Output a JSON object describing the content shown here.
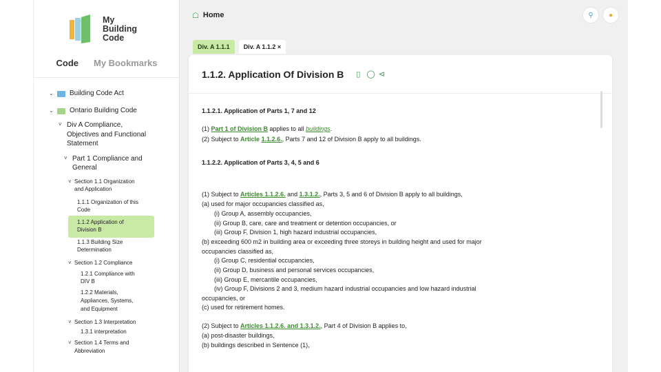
{
  "logo": {
    "line1": "My",
    "line2": "Building",
    "line3": "Code"
  },
  "sidebar": {
    "tab_code": "Code",
    "tab_bookmarks": "My Bookmarks",
    "tree": {
      "act": "Building Code Act",
      "obc": "Ontario Building Code",
      "divA_1": "Div A Compliance,",
      "divA_2": "Objectives and Functional",
      "divA_3": "Statement",
      "part1_1": "Part 1 Compliance and",
      "part1_2": "General",
      "s11_1": "Section 1.1 Organization",
      "s11_2": "and Application",
      "i111_1": "1.1.1 Organization of this",
      "i111_2": "Code",
      "i112_1": "1.1.2 Application of",
      "i112_2": "Division B",
      "i113_1": "1.1.3 Building Size",
      "i113_2": "Determination",
      "s12": "Section 1.2 Compliance",
      "i121_1": "1.2.1 Compliance with",
      "i121_2": "DIV B",
      "i122_1": "1.2.2 Materials,",
      "i122_2": "Appliances,  Systems,",
      "i122_3": "and Equipment",
      "s13": "Section 1.3 Interpretation",
      "i131": "1.3.1 interpretation",
      "s14_1": "Section 1.4 Terms and",
      "s14_2": "Abbreviation"
    }
  },
  "topbar": {
    "home": "Home"
  },
  "tabs": {
    "tab1": "Div. A 1.1.1",
    "tab2": "Div. A 1.1.2 ×"
  },
  "article": {
    "title": "1.1.2.  Application Of Division B",
    "h1": "1.1.2.1.  Application of Parts 1, 7 and 12",
    "p1_a": "(1)  ",
    "p1_link": "Part 1 of Division B",
    "p1_b": " applies to all ",
    "p1_term": "buildings",
    "p1_c": ".",
    "p2_a": "(2)  Subject to ",
    "p2_link1": "Article",
    "p2_sp": " ",
    "p2_link2": "1.1.2.6.",
    "p2_b": ", Parts 7 and 12 of Division B apply to all buildings.",
    "h2": "1.1.2.2.  Application of Parts 3, 4, 5 and 6",
    "q1_a": "(1)  Subject to ",
    "q1_link1": "Articles 1.1.2.6.",
    "q1_b": " and ",
    "q1_link2": "1.3.1.2.",
    "q1_c": ", Parts 3, 5 and 6 of Division B apply to all buildings,",
    "qa": "(a)   used for major occupancies classified as,",
    "qa_i": "(i)    Group A, assembly occupancies,",
    "qa_ii": "(ii)   Group B, care, care and treatment or detention occupancies, or",
    "qa_iii": "(iii)  Group F, Division 1, high hazard industrial occupancies,",
    "qb": "(b)   exceeding 600 m2 in building area or exceeding three storeys in building height and used for major",
    "qb2": "occupancies classified as,",
    "qb_i": "(i)    Group C, residential occupancies,",
    "qb_ii": "(ii)   Group D, business and personal services occupancies,",
    "qb_iii": "(iii)  Group E, mercantile occupancies,",
    "qb_iv": "(iv)  Group F, Divisions 2 and 3, medium hazard industrial occupancies and low hazard industrial",
    "qb_iv2": "occupancies, or",
    "qc": "(c)   used for retirement homes.",
    "r2_a": "(2)  Subject to ",
    "r2_link": "Articles 1.1.2.6. and 1.3.1.2.",
    "r2_b": ", Part 4 of Division B applies to,",
    "ra": "(a)   post-disaster buildings,",
    "rb": "(b)   buildings described in Sentence (1),"
  },
  "colors": {
    "accent": "#3d9a52",
    "tab_green": "#c9eaa4",
    "selected_bg": "#c9eaa4"
  }
}
